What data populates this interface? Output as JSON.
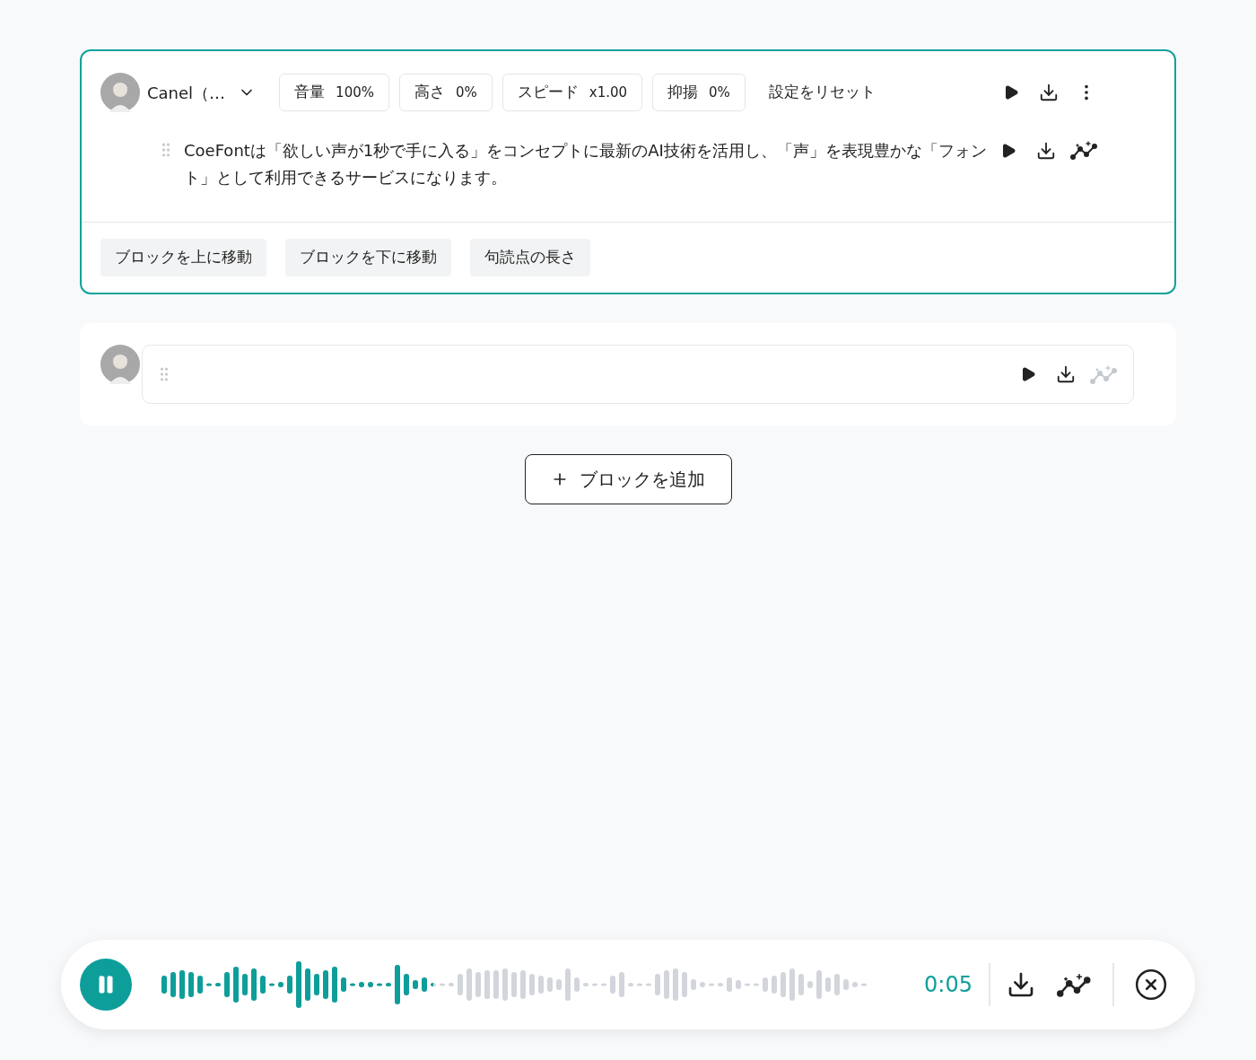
{
  "blocks": [
    {
      "selected": true,
      "voice": {
        "name": "Canel（…"
      },
      "params": [
        {
          "label": "音量",
          "value": "100%"
        },
        {
          "label": "高さ",
          "value": "0%"
        },
        {
          "label": "スピード",
          "value": "x1.00"
        },
        {
          "label": "抑揚",
          "value": "0%"
        }
      ],
      "reset": "設定をリセット",
      "text": "CoeFontは「欲しい声が1秒で手に入る」をコンセプトに最新のAI技術を活用し、「声」を表現豊かな「フォント」として利用できるサービスになります。",
      "enhance_disabled": false,
      "actions": [
        "ブロックを上に移動",
        "ブロックを下に移動",
        "句読点の長さ"
      ]
    },
    {
      "selected": false,
      "enhance_disabled": true
    }
  ],
  "add_block": "ブロックを追加",
  "player": {
    "playing": true,
    "level": 0.39,
    "time": "0:05"
  }
}
